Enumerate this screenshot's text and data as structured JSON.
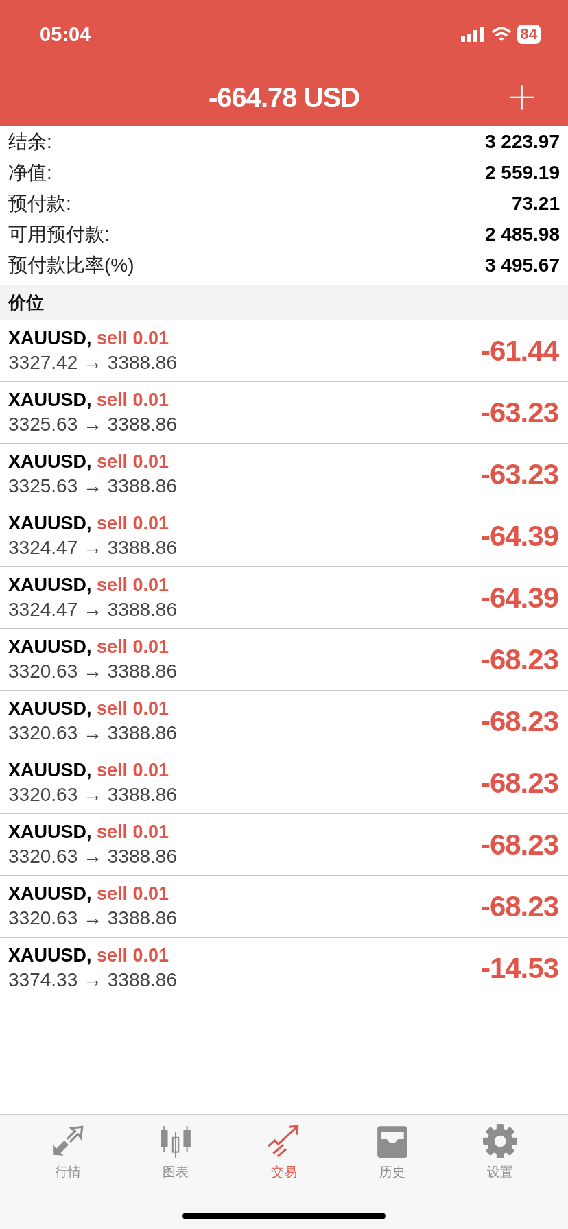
{
  "status_bar": {
    "time": "05:04",
    "battery": "84"
  },
  "header": {
    "title": "-664.78 USD",
    "add_button": "+"
  },
  "summary": [
    {
      "label": "结余:",
      "value": "3 223.97"
    },
    {
      "label": "净值:",
      "value": "2 559.19"
    },
    {
      "label": "预付款:",
      "value": "73.21"
    },
    {
      "label": "可用预付款:",
      "value": "2 485.98"
    },
    {
      "label": "预付款比率(%)",
      "value": "3 495.67"
    }
  ],
  "section_title": "价位",
  "positions": [
    {
      "symbol": "XAUUSD,",
      "side": "sell 0.01",
      "prices": "3327.42 → 3388.86",
      "profit": "-61.44"
    },
    {
      "symbol": "XAUUSD,",
      "side": "sell 0.01",
      "prices": "3325.63 → 3388.86",
      "profit": "-63.23"
    },
    {
      "symbol": "XAUUSD,",
      "side": "sell 0.01",
      "prices": "3325.63 → 3388.86",
      "profit": "-63.23"
    },
    {
      "symbol": "XAUUSD,",
      "side": "sell 0.01",
      "prices": "3324.47 → 3388.86",
      "profit": "-64.39"
    },
    {
      "symbol": "XAUUSD,",
      "side": "sell 0.01",
      "prices": "3324.47 → 3388.86",
      "profit": "-64.39"
    },
    {
      "symbol": "XAUUSD,",
      "side": "sell 0.01",
      "prices": "3320.63 → 3388.86",
      "profit": "-68.23"
    },
    {
      "symbol": "XAUUSD,",
      "side": "sell 0.01",
      "prices": "3320.63 → 3388.86",
      "profit": "-68.23"
    },
    {
      "symbol": "XAUUSD,",
      "side": "sell 0.01",
      "prices": "3320.63 → 3388.86",
      "profit": "-68.23"
    },
    {
      "symbol": "XAUUSD,",
      "side": "sell 0.01",
      "prices": "3320.63 → 3388.86",
      "profit": "-68.23"
    },
    {
      "symbol": "XAUUSD,",
      "side": "sell 0.01",
      "prices": "3320.63 → 3388.86",
      "profit": "-68.23"
    },
    {
      "symbol": "XAUUSD,",
      "side": "sell 0.01",
      "prices": "3374.33 → 3388.86",
      "profit": "-14.53"
    }
  ],
  "tabs": [
    {
      "kind": "quotes",
      "label": "行情",
      "selected": false
    },
    {
      "kind": "chart",
      "label": "图表",
      "selected": false
    },
    {
      "kind": "trade",
      "label": "交易",
      "selected": true
    },
    {
      "kind": "history",
      "label": "历史",
      "selected": false
    },
    {
      "kind": "settings",
      "label": "设置",
      "selected": false
    }
  ]
}
